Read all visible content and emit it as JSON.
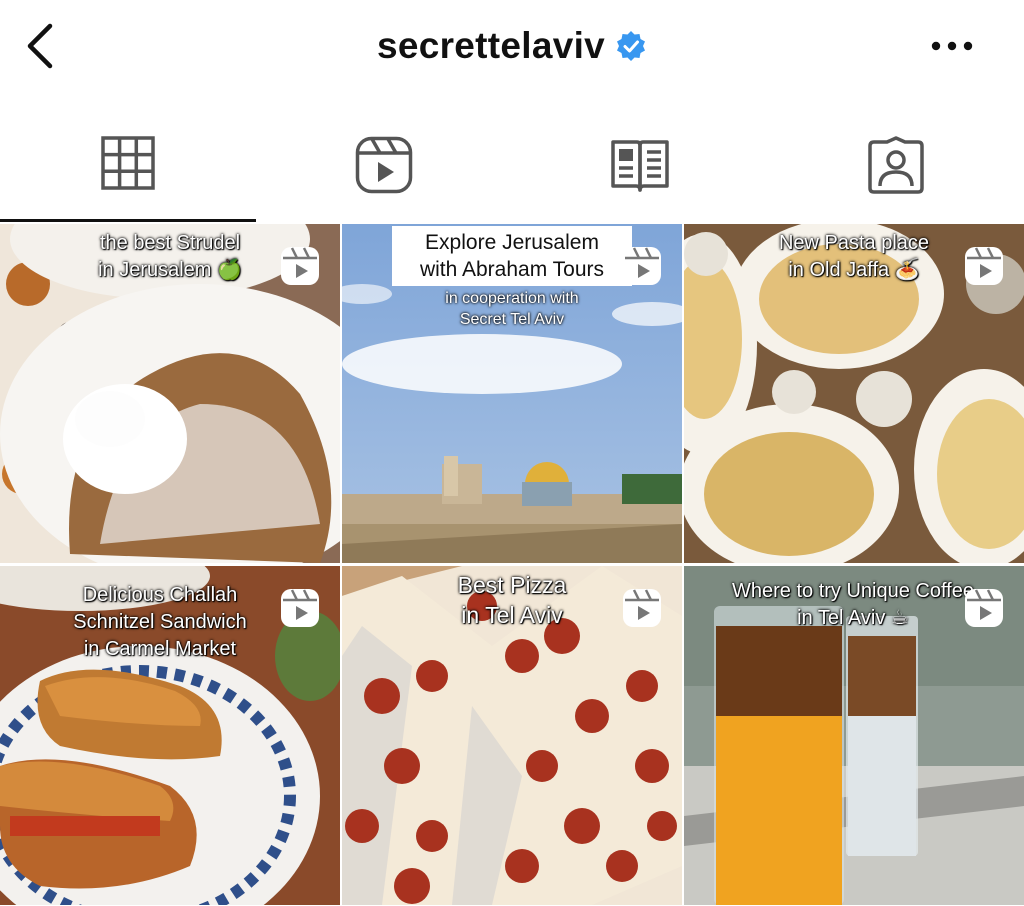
{
  "header": {
    "username": "secrettelaviv",
    "verified": true,
    "icons": {
      "back": "chevron-left-icon",
      "more": "more-horizontal-icon",
      "verified": "verified-badge-icon"
    }
  },
  "tabs": [
    {
      "id": "posts",
      "icon": "grid-icon",
      "active": true
    },
    {
      "id": "reels",
      "icon": "reels-icon",
      "active": false
    },
    {
      "id": "guides",
      "icon": "guide-book-icon",
      "active": false
    },
    {
      "id": "tagged",
      "icon": "tagged-person-icon",
      "active": false
    }
  ],
  "posts": [
    {
      "caption": "the best Strudel\nin Jerusalem 🍏",
      "type": "reel"
    },
    {
      "caption": "Explore Jerusalem\nwith Abraham Tours",
      "subcaption": "in cooperation with\nSecret Tel Aviv",
      "type": "reel"
    },
    {
      "caption": "New Pasta place\nin Old Jaffa 🍝",
      "type": "reel"
    },
    {
      "caption": "Delicious Challah\nSchnitzel Sandwich\nin Carmel Market",
      "type": "reel"
    },
    {
      "caption": "Best Pizza\nin Tel Aviv",
      "type": "reel"
    },
    {
      "caption": "Where to try Unique Coffee\nin Tel Aviv ☕",
      "type": "reel"
    }
  ],
  "colors": {
    "accent": "#3897f0",
    "text": "#111111",
    "icon": "#555555"
  }
}
